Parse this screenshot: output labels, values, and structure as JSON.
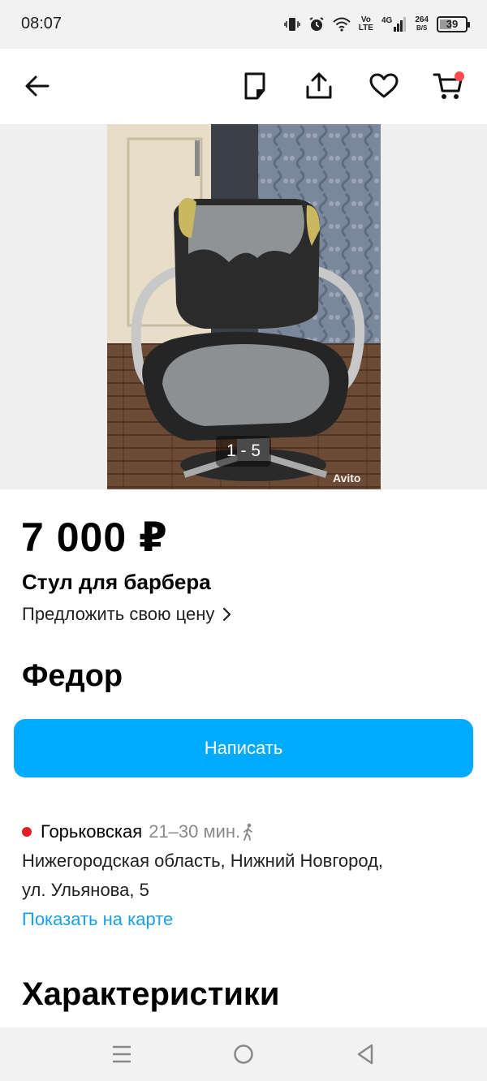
{
  "status_bar": {
    "time": "08:07",
    "volte_top": "Vo",
    "volte_bottom": "LTE",
    "network": "4G",
    "speed_value": "264",
    "speed_unit": "B/S",
    "battery_level": "39"
  },
  "app_bar": {
    "icons": [
      "back-arrow-icon",
      "note-icon",
      "share-icon",
      "heart-icon",
      "cart-icon"
    ],
    "cart_badge_color": "#ff4d4d"
  },
  "gallery": {
    "counter": "1 - 5",
    "watermark": "Avito"
  },
  "listing": {
    "price": "7 000 ₽",
    "title": "Стул для барбера",
    "offer_label": "Предложить свою цену",
    "seller_name": "Федор",
    "write_button": "Написать"
  },
  "location": {
    "metro_station": "Горьковская",
    "metro_time": "21–30 мин.",
    "metro_color": "#e31e24",
    "address_line1": "Нижегородская область, Нижний Новгород,",
    "address_line2": "ул. Ульянова, 5",
    "map_link": "Показать на карте"
  },
  "sections": {
    "characteristics": "Характеристики"
  },
  "colors": {
    "accent": "#00aaff",
    "link": "#1a9fe8"
  }
}
